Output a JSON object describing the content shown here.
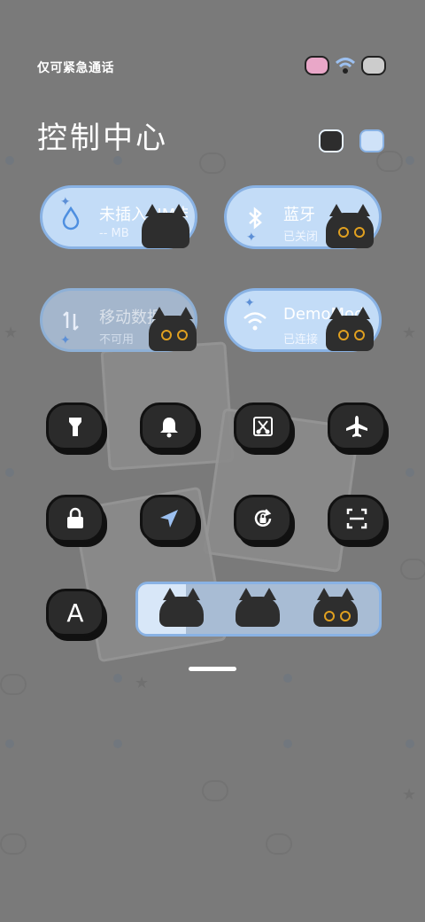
{
  "status_bar": {
    "carrier_text": "仅可紧急通话",
    "icons": [
      "cat-sim-icon",
      "wifi-icon",
      "cat-battery-icon"
    ]
  },
  "header": {
    "title": "控制中心",
    "icons": [
      "cat-settings-icon",
      "edit-icon"
    ]
  },
  "tiles": [
    {
      "id": "data-usage",
      "main": "未插入SIM卡",
      "sub": "-- MB",
      "icon": "water-drop-icon"
    },
    {
      "id": "bluetooth",
      "main": "蓝牙",
      "sub": "已关闭",
      "icon": "bluetooth-icon"
    },
    {
      "id": "mobile-data",
      "main": "移动数据",
      "sub": "不可用",
      "icon": "mobile-data-icon"
    },
    {
      "id": "wifi",
      "main": "DemoMod",
      "sub": "已连接",
      "icon": "wifi-icon"
    }
  ],
  "toggles_row1": [
    "flashlight-icon",
    "bell-icon",
    "screenshot-icon",
    "airplane-icon"
  ],
  "toggles_row2": [
    "lock-icon",
    "location-icon",
    "rotation-lock-icon",
    "scan-icon"
  ],
  "toggles_row3": {
    "letter": "A",
    "brightness_level": 0.2
  },
  "colors": {
    "accent": "#89b2e4",
    "tile_fill": "#c3dcf7",
    "dark": "#2b2b2b"
  }
}
